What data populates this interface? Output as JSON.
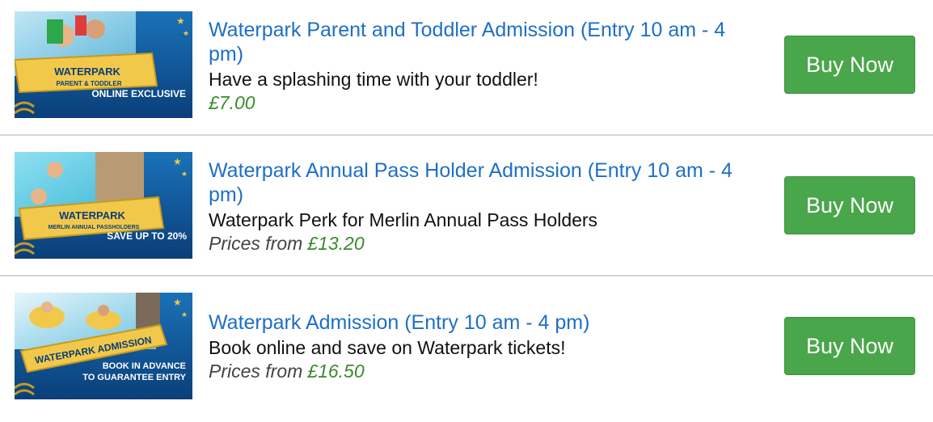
{
  "products": [
    {
      "title": "Waterpark Parent and Toddler Admission (Entry 10 am - 4 pm)",
      "description": "Have a splashing time with your toddler!",
      "price_prefix": "",
      "price": "£7.00",
      "button_label": "Buy Now",
      "banner": {
        "brand": "WATERPARK",
        "sub": "PARENT & TODDLER",
        "tagline": "ONLINE EXCLUSIVE"
      }
    },
    {
      "title": "Waterpark Annual Pass Holder Admission (Entry 10 am - 4 pm)",
      "description": "Waterpark Perk for Merlin Annual Pass Holders",
      "price_prefix": "Prices from",
      "price": "£13.20",
      "button_label": "Buy Now",
      "banner": {
        "brand": "WATERPARK",
        "sub": "MERLIN ANNUAL PASSHOLDERS",
        "tagline": "SAVE UP TO 20%"
      }
    },
    {
      "title": "Waterpark Admission (Entry 10 am - 4 pm)",
      "description": "Book online and save on Waterpark tickets!",
      "price_prefix": "Prices from",
      "price": "£16.50",
      "button_label": "Buy Now",
      "banner": {
        "brand": "WATERPARK ADMISSION",
        "tagline_line1": "BOOK IN ADVANCE",
        "tagline_line2": "TO GUARANTEE ENTRY"
      }
    }
  ],
  "colors": {
    "title": "#1f6fc5",
    "price": "#3a8a2e",
    "button": "#4aa64a",
    "banner_blue": "#0d5fa8"
  }
}
